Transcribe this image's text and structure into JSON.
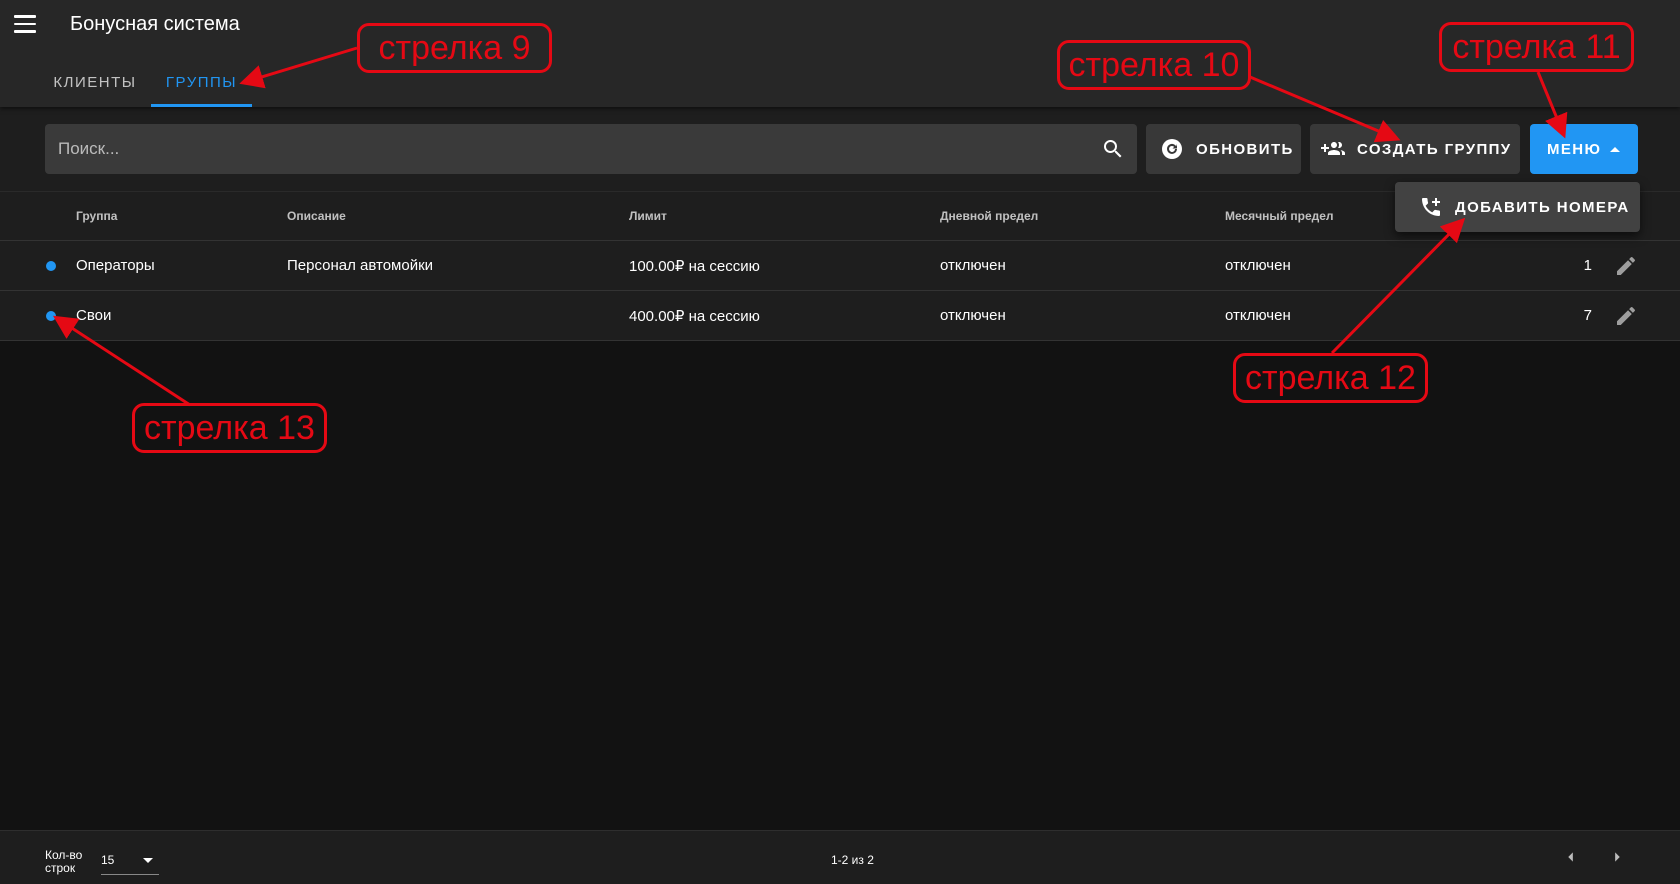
{
  "app": {
    "title": "Бонусная система"
  },
  "tabs": [
    {
      "label": "КЛИЕНТЫ"
    },
    {
      "label": "ГРУППЫ"
    }
  ],
  "toolbar": {
    "search_placeholder": "Поиск...",
    "refresh_label": "ОБНОВИТЬ",
    "create_label": "СОЗДАТЬ ГРУППУ",
    "menu_label": "МЕНЮ"
  },
  "dropdown": {
    "add_numbers_label": "ДОБАВИТЬ НОМЕРА"
  },
  "table": {
    "headers": [
      "Группа",
      "Описание",
      "Лимит",
      "Дневной предел",
      "Месячный предел"
    ],
    "rows": [
      {
        "group": "Операторы",
        "description": "Персонал автомойки",
        "limit": "100.00₽ на сессию",
        "daily": "отключен",
        "monthly": "отключен",
        "count": "1"
      },
      {
        "group": "Свои",
        "description": "",
        "limit": "400.00₽ на сессию",
        "daily": "отключен",
        "monthly": "отключен",
        "count": "7"
      }
    ]
  },
  "footer": {
    "rows_label": "Кол-во строк",
    "rows_value": "15",
    "pagination": "1-2 из 2"
  },
  "annotations": [
    {
      "label": "стрелка 9"
    },
    {
      "label": "стрелка 10"
    },
    {
      "label": "стрелка 11"
    },
    {
      "label": "стрелка 12"
    },
    {
      "label": "стрелка 13"
    }
  ],
  "colors": {
    "accent": "#2196f3",
    "annotation": "#e50914",
    "background": "#121212",
    "surface": "#1e1e1e",
    "app_bar": "#272727"
  },
  "icons": [
    "menu-icon",
    "search-icon",
    "refresh-icon",
    "group-add-icon",
    "caret-up-icon",
    "phone-add-icon",
    "edit-icon",
    "chevron-left-icon",
    "chevron-right-icon",
    "dropdown-arrow-icon"
  ]
}
